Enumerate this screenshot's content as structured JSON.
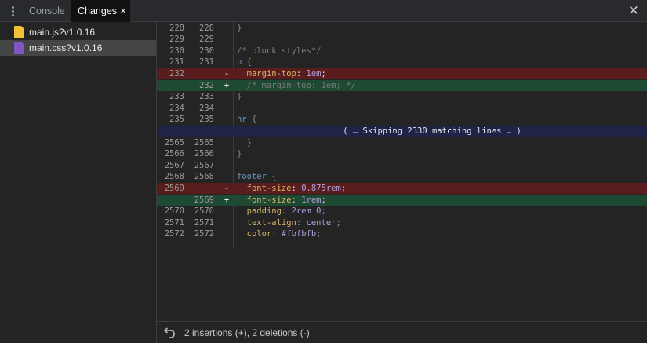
{
  "tabs": {
    "console": "Console",
    "changes": "Changes",
    "changes_close": "×"
  },
  "panel": {
    "close_glyph": "✕"
  },
  "files": [
    {
      "name": "main.js?v1.0.16",
      "type": "js",
      "color": "#f1c232",
      "selected": false
    },
    {
      "name": "main.css?v1.0.16",
      "type": "css",
      "color": "#7e57c2",
      "selected": true
    }
  ],
  "diff": {
    "rows": [
      {
        "type": "ctx",
        "l1": "228",
        "l2": "228",
        "code": "}"
      },
      {
        "type": "ctx",
        "l1": "229",
        "l2": "229",
        "code": ""
      },
      {
        "type": "ctx",
        "l1": "230",
        "l2": "230",
        "code": "/* block styles*/"
      },
      {
        "type": "ctx",
        "l1": "231",
        "l2": "231",
        "code": "p {"
      },
      {
        "type": "del",
        "l1": "232",
        "l2": "",
        "mark": "-",
        "code": "  margin-top: 1em;"
      },
      {
        "type": "add",
        "l1": "",
        "l2": "232",
        "mark": "+",
        "code": "  /* margin-top: 1em; */"
      },
      {
        "type": "ctx",
        "l1": "233",
        "l2": "233",
        "code": "}"
      },
      {
        "type": "ctx",
        "l1": "234",
        "l2": "234",
        "code": ""
      },
      {
        "type": "ctx",
        "l1": "235",
        "l2": "235",
        "code": "hr {"
      },
      {
        "type": "skip",
        "text": "( … Skipping 2330 matching lines … )"
      },
      {
        "type": "ctx",
        "l1": "2565",
        "l2": "2565",
        "code": "  }"
      },
      {
        "type": "ctx",
        "l1": "2566",
        "l2": "2566",
        "code": "}"
      },
      {
        "type": "ctx",
        "l1": "2567",
        "l2": "2567",
        "code": ""
      },
      {
        "type": "ctx",
        "l1": "2568",
        "l2": "2568",
        "code": "footer {"
      },
      {
        "type": "del",
        "l1": "2569",
        "l2": "",
        "mark": "-",
        "code": "  font-size: 0.875rem;"
      },
      {
        "type": "add",
        "l1": "",
        "l2": "2569",
        "mark": "+",
        "code": "  font-size: 1rem;"
      },
      {
        "type": "ctx",
        "l1": "2570",
        "l2": "2570",
        "code": "  padding: 2rem 0;"
      },
      {
        "type": "ctx",
        "l1": "2571",
        "l2": "2571",
        "code": "  text-align: center;"
      },
      {
        "type": "ctx",
        "l1": "2572",
        "l2": "2572",
        "code": "  color: #fbfbfb;"
      }
    ]
  },
  "footer": {
    "summary": "2 insertions (+), 2 deletions (-)",
    "undo_icon": "undo-icon"
  }
}
